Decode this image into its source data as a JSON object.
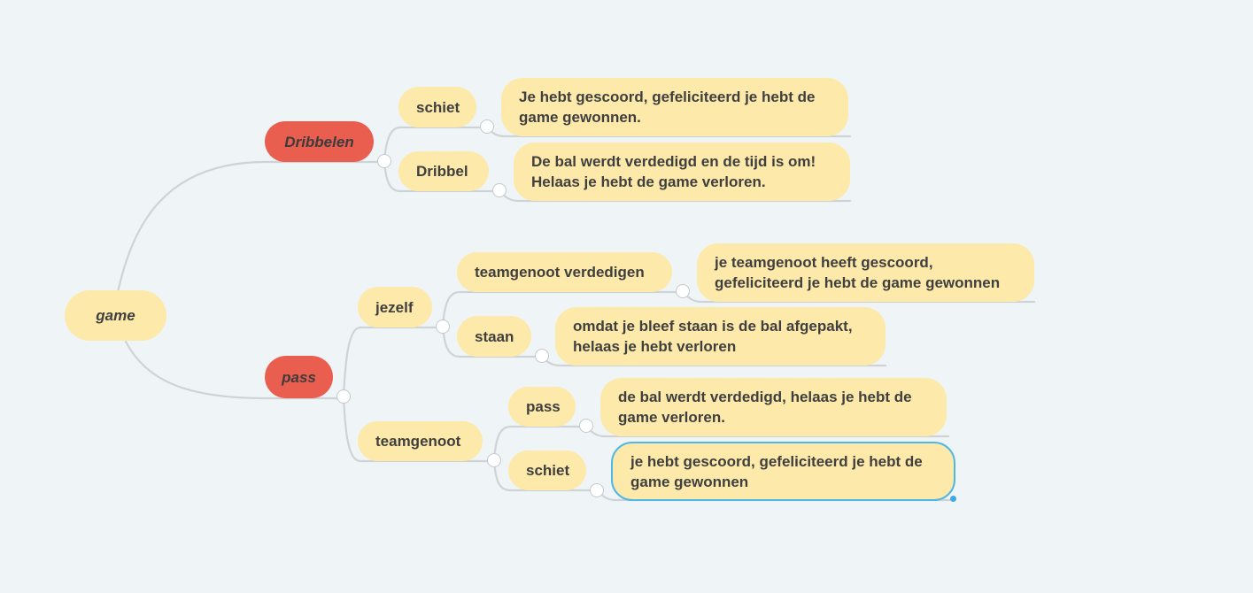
{
  "mindmap": {
    "root": {
      "label": "game"
    },
    "branch_dribbelen": {
      "label": "Dribbelen",
      "schiet": {
        "label": "schiet",
        "result": "Je hebt gescoord, gefeliciteerd je hebt de game gewonnen."
      },
      "dribbel": {
        "label": "Dribbel",
        "result": "De bal werdt verdedigd en de tijd is om! Helaas je hebt de game verloren."
      }
    },
    "branch_pass": {
      "label": "pass",
      "jezelf": {
        "label": "jezelf",
        "teamgenoot_verdedigen": {
          "label": "teamgenoot verdedigen",
          "result": "je teamgenoot heeft gescoord, gefeliciteerd je hebt de game gewonnen"
        },
        "staan": {
          "label": "staan",
          "result": "omdat je bleef staan is de bal afgepakt, helaas je hebt verloren"
        }
      },
      "teamgenoot": {
        "label": "teamgenoot",
        "pass": {
          "label": "pass",
          "result": "de bal werdt verdedigd, helaas je hebt de game verloren."
        },
        "schiet": {
          "label": "schiet",
          "result": "je hebt gescoord, gefeliciteerd je hebt de game gewonnen"
        }
      }
    }
  },
  "colors": {
    "background": "#eff4f7",
    "node_fill": "#fde9a9",
    "main_branch_fill": "#ea5e4f",
    "connector": "#cfd3d6",
    "selection": "#4fb6e8",
    "text": "#3f3f3f"
  }
}
